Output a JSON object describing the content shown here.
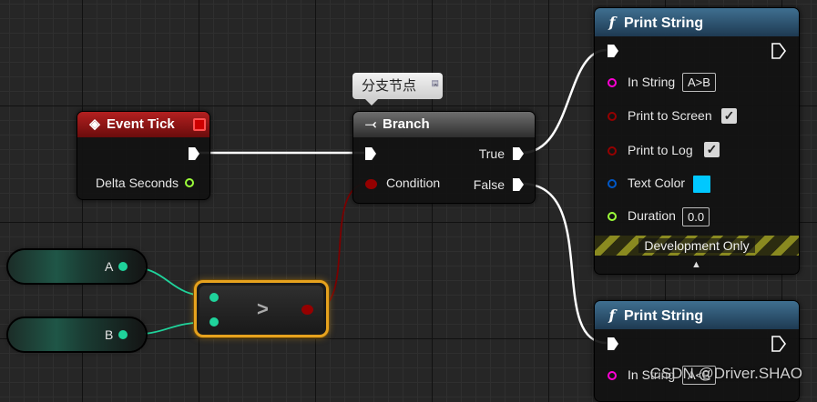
{
  "comment": {
    "text": "分支节点"
  },
  "event_tick": {
    "title": "Event Tick",
    "output_label": "Delta Seconds"
  },
  "branch": {
    "title": "Branch",
    "condition_label": "Condition",
    "true_label": "True",
    "false_label": "False"
  },
  "print_string_1": {
    "title": "Print String",
    "in_string_label": "In String",
    "in_string_value": "A>B",
    "print_to_screen_label": "Print to Screen",
    "print_to_screen_checked": true,
    "print_to_log_label": "Print to Log",
    "print_to_log_checked": true,
    "text_color_label": "Text Color",
    "text_color_value": "#00c8ff",
    "duration_label": "Duration",
    "duration_value": "0.0",
    "dev_only_label": "Development Only"
  },
  "print_string_2": {
    "title": "Print String",
    "in_string_label": "In String",
    "in_string_value": "A<B"
  },
  "variables": {
    "a_label": "A",
    "b_label": "B"
  },
  "compare": {
    "operator": ">"
  },
  "watermark": {
    "text": "CSDN @Driver.SHAO"
  },
  "colors": {
    "exec": "#ffffff",
    "float_pin": "#1fd39b",
    "bool_pin": "#950000",
    "string_pin": "#ff00d4",
    "linear_color_pin": "#0058c8",
    "duration_pin": "#9cff3a",
    "compare_border": "#e6a21e"
  }
}
